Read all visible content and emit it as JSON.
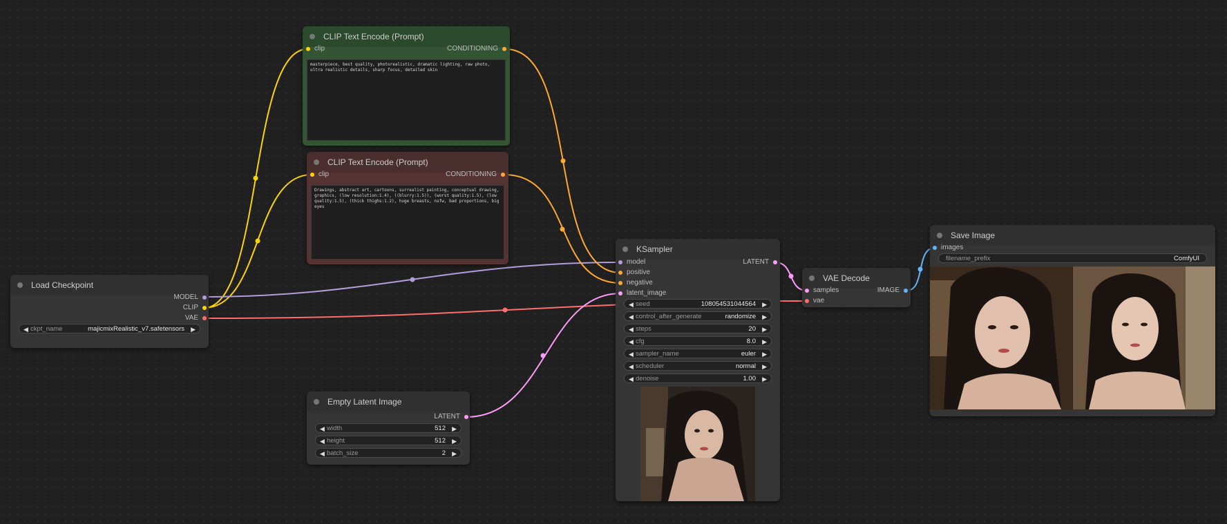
{
  "colors": {
    "clip": "#ffd500",
    "conditioning": "#ffa931",
    "model": "#b39ddb",
    "vae": "#ff6e6e",
    "latent": "#ff9cf9",
    "image": "#64b5f6"
  },
  "nodes": {
    "load_checkpoint": {
      "title": "Load Checkpoint",
      "outputs": [
        "MODEL",
        "CLIP",
        "VAE"
      ],
      "ckpt_label": "ckpt_name",
      "ckpt_value": "majicmixRealistic_v7.safetensors"
    },
    "clip_positive": {
      "title": "CLIP Text Encode (Prompt)",
      "input": "clip",
      "output": "CONDITIONING",
      "text": "masterpiece, best quality, photorealistic, dramatic lighting, raw photo, ultra realistic details, sharp focus, detailed skin"
    },
    "clip_negative": {
      "title": "CLIP Text Encode (Prompt)",
      "input": "clip",
      "output": "CONDITIONING",
      "text": "Drawings, abstract art, cartoons, surrealist painting, conceptual drawing, graphics, (low resolution:1.4), ((blurry:1.5)), (worst quality:1.5), (low quality:1.5), (thick thighs:1.2), huge breasts, nsfw, bad proportions, big eyes"
    },
    "empty_latent": {
      "title": "Empty Latent Image",
      "output": "LATENT",
      "widgets": [
        {
          "label": "width",
          "value": "512"
        },
        {
          "label": "height",
          "value": "512"
        },
        {
          "label": "batch_size",
          "value": "2"
        }
      ]
    },
    "ksampler": {
      "title": "KSampler",
      "inputs": [
        "model",
        "positive",
        "negative",
        "latent_image"
      ],
      "output": "LATENT",
      "widgets": [
        {
          "label": "seed",
          "value": "1080545310445​64"
        },
        {
          "label": "control_after_generate",
          "value": "randomize"
        },
        {
          "label": "steps",
          "value": "20"
        },
        {
          "label": "cfg",
          "value": "8.0"
        },
        {
          "label": "sampler_name",
          "value": "euler"
        },
        {
          "label": "scheduler",
          "value": "normal"
        },
        {
          "label": "denoise",
          "value": "1.00"
        }
      ]
    },
    "vae_decode": {
      "title": "VAE Decode",
      "inputs": [
        "samples",
        "vae"
      ],
      "output": "IMAGE"
    },
    "save_image": {
      "title": "Save Image",
      "input": "images",
      "prefix_label": "filename_prefix",
      "prefix_value": "ComfyUI"
    }
  }
}
